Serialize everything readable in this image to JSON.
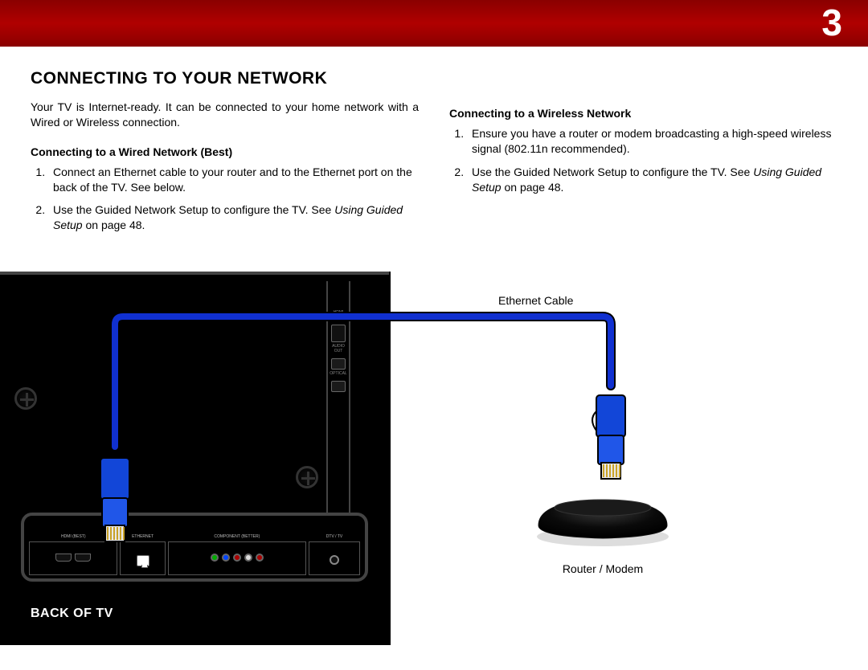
{
  "header": {
    "chapter_number": "3"
  },
  "section_title": "CONNECTING TO YOUR NETWORK",
  "intro": "Your TV is Internet-ready. It can be connected to your home network with a Wired or Wireless connection.",
  "wired": {
    "heading": "Connecting to a Wired Network (Best)",
    "steps": [
      "Connect an Ethernet cable to your router and to the Ethernet port on the back of the TV. See below.",
      "Use the Guided Network Setup to configure the TV."
    ],
    "see_prefix": "See ",
    "see_italic": "Using Guided Setup",
    "see_suffix": " on page 48."
  },
  "wireless": {
    "heading": "Connecting to a Wireless Network",
    "steps": [
      "Ensure you have a router or modem broadcasting a high-speed wireless signal (802.11n recommended).",
      "Use the Guided Network Setup to configure the TV."
    ],
    "see_prefix": "See ",
    "see_italic": "Using Guided Setup",
    "see_suffix": " on page 48."
  },
  "diagram": {
    "back_of_tv_label": "BACK OF TV",
    "ethernet_cable_label": "Ethernet Cable",
    "router_label": "Router / Modem",
    "port_strip": {
      "groups": [
        {
          "label": "HDMI (BEST)"
        },
        {
          "label": "ETHERNET"
        },
        {
          "label": "COMPONENT (BETTER)"
        },
        {
          "label": "DTV / TV"
        }
      ]
    },
    "vertical_port_labels": [
      "HDMI (BEST)",
      "AUDIO OUT",
      "OPTICAL"
    ]
  }
}
